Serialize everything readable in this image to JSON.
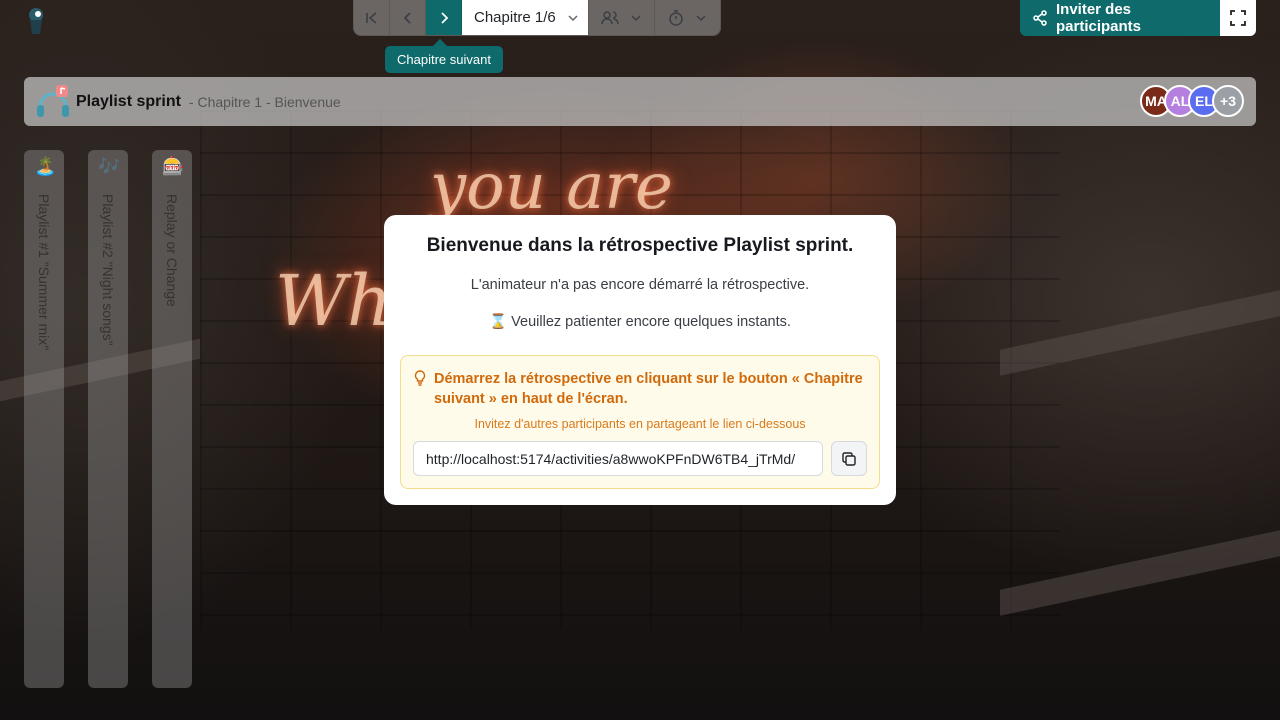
{
  "toolbar": {
    "first_label": "Premier chapitre",
    "prev_label": "Chapitre précédent",
    "next_label": "Chapitre suivant",
    "chapter": "Chapitre 1/6",
    "tooltip": "Chapitre suivant"
  },
  "invite": {
    "label": "Inviter des participants"
  },
  "header": {
    "title": "Playlist sprint",
    "subtitle": "- Chapitre 1 - Bienvenue",
    "avatars": [
      {
        "initials": "MA",
        "color": "#7a2a18"
      },
      {
        "initials": "AL",
        "color": "#b57fe0"
      },
      {
        "initials": "EL",
        "color": "#5a6cf0"
      },
      {
        "initials": "+3",
        "color": "#9aa0a6"
      }
    ]
  },
  "columns": [
    {
      "label": "Playlist #1 \"Summer mix\"",
      "icon": "🏝️"
    },
    {
      "label": "Playlist #2 \"Night songs\"",
      "icon": "🎶"
    },
    {
      "label": "Replay or Change",
      "icon": "🎰"
    }
  ],
  "modal": {
    "title": "Bienvenue dans la rétrospective Playlist sprint.",
    "line1": "L'animateur n'a pas encore démarré la rétrospective.",
    "line2": "⌛ Veuillez patienter encore quelques instants.",
    "hint": "Démarrez la rétrospective en cliquant sur le bouton « Chapitre suivant » en haut de l'écran.",
    "invite_text": "Invitez d'autres participants en partageant le lien ci-dessous",
    "link": "http://localhost:5174/activities/a8wwoKPFnDW6TB4_jTrMd/"
  },
  "colors": {
    "accent": "#0f6b6b",
    "hint": "#d06a0c"
  }
}
